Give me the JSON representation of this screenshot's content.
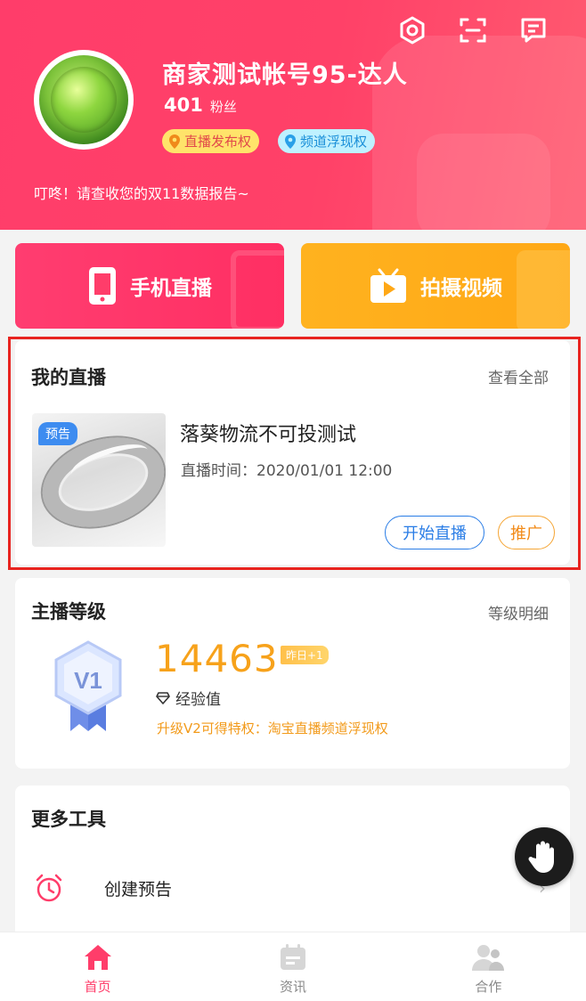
{
  "header": {
    "nickname": "商家测试帐号95-达人",
    "fans_count": "401",
    "fans_label": "粉丝",
    "badges": [
      "直播发布权",
      "频道浮现权"
    ],
    "notice": "叮咚！请查收您的双11数据报告~",
    "icons": [
      "settings-icon",
      "scan-icon",
      "message-icon"
    ]
  },
  "actions": {
    "live_button": "手机直播",
    "video_button": "拍摄视频"
  },
  "my_live": {
    "title": "我的直播",
    "view_all": "查看全部",
    "item": {
      "tag": "预告",
      "title": "落葵物流不可投测试",
      "time_label": "直播时间：",
      "time_value": "2020/01/01 12:00",
      "start_button": "开始直播",
      "promote_button": "推广"
    }
  },
  "level": {
    "title": "主播等级",
    "detail_link": "等级明细",
    "badge": "V1",
    "exp_value": "14463",
    "yesterday_tag": "昨日+1",
    "exp_label": "经验值",
    "upgrade_text": "升级V2可得特权：淘宝直播频道浮现权"
  },
  "tools": {
    "title": "更多工具",
    "items": [
      {
        "label": "创建预告",
        "icon": "alarm-clock-icon"
      }
    ]
  },
  "bottom_nav": {
    "items": [
      {
        "label": "首页",
        "icon": "home-icon",
        "active": true
      },
      {
        "label": "资讯",
        "icon": "news-icon",
        "active": false
      },
      {
        "label": "合作",
        "icon": "cooperation-icon",
        "active": false
      }
    ]
  },
  "colors": {
    "brand": "#ff3d6a",
    "accent_orange": "#f7a21b",
    "link_blue": "#2a7de6",
    "nav_active": "#ff3d6a",
    "nav_inactive": "#888888"
  }
}
